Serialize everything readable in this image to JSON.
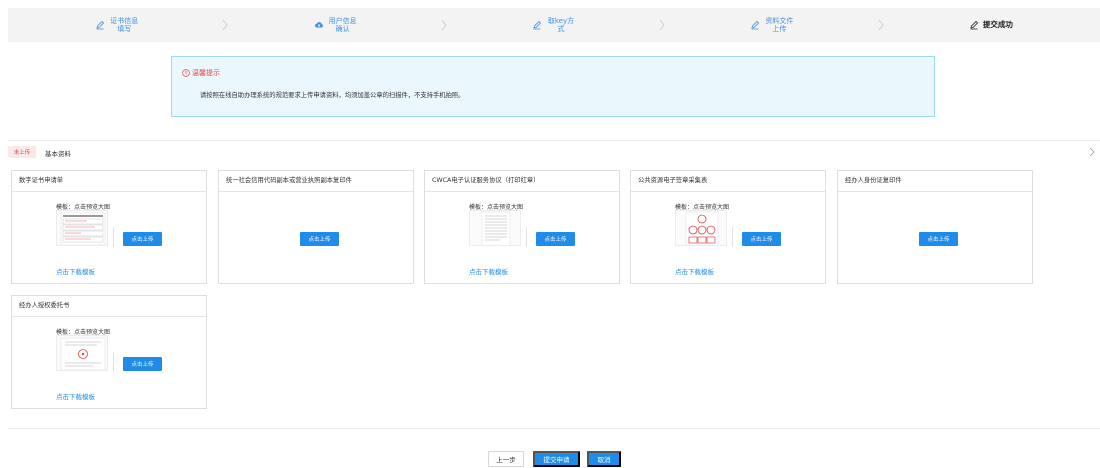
{
  "steps": [
    {
      "label": "证书信息填写",
      "icon": "pencil-icon"
    },
    {
      "label": "用户信息确认",
      "icon": "cloud-upload-icon"
    },
    {
      "label": "取key方式",
      "icon": "pencil-icon"
    },
    {
      "label": "资料文件上传",
      "icon": "pencil-icon"
    },
    {
      "label": "提交成功",
      "icon": "pencil-icon"
    }
  ],
  "notice": {
    "title": "温馨提示",
    "message": "请按照在线自助办理系统的规范要求上传申请资料，均须加盖公章的扫描件，不支持手机拍照。"
  },
  "status": {
    "pill": "未上传",
    "tab": "基本资料"
  },
  "cards": [
    {
      "title": "数字证书申请单",
      "template_label": "模板：点击预览大图",
      "upload_label": "点击上传",
      "download_label": "点击下载模板"
    },
    {
      "title": "统一社会信用代码副本或营业执照副本复印件",
      "upload_label": "点击上传"
    },
    {
      "title": "CWCA电子认证服务协议（打印红章）",
      "template_label": "模板：点击预览大图",
      "upload_label": "点击上传",
      "download_label": "点击下载模板"
    },
    {
      "title": "公共资源电子签章采集表",
      "template_label": "模板：点击预览大图",
      "upload_label": "点击上传",
      "download_label": "点击下载模板"
    },
    {
      "title": "经办人身份证复印件",
      "upload_label": "点击上传"
    },
    {
      "title": "经办人授权委托书",
      "template_label": "模板：点击预览大图",
      "upload_label": "点击上传",
      "download_label": "点击下载模板"
    }
  ],
  "footer": {
    "prev": "上一步",
    "submit": "提交申请",
    "cancel": "取消"
  },
  "colors": {
    "primary": "#1e8ce8",
    "notice_bg": "#eaf7fd",
    "warning": "#e04747"
  }
}
